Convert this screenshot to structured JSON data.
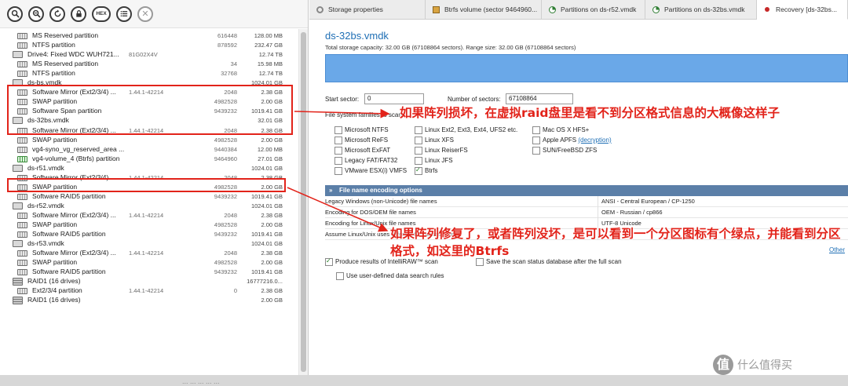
{
  "toolbar": {
    "buttons": [
      {
        "label": "",
        "icon": "search-icon"
      },
      {
        "label": "",
        "icon": "zoom-icon"
      },
      {
        "label": "",
        "icon": "refresh-icon"
      },
      {
        "label": "",
        "icon": "lock-icon"
      },
      {
        "label": "HEX",
        "icon": "hex-icon"
      },
      {
        "label": "",
        "icon": "list-icon"
      },
      {
        "label": "✕",
        "icon": "close-icon"
      }
    ]
  },
  "tree": [
    {
      "name": "MS Reserved partition",
      "pos": "",
      "sectors": "616448",
      "size": "128.00 MB",
      "icon": "partition"
    },
    {
      "name": "NTFS partition",
      "pos": "",
      "sectors": "878592",
      "size": "232.47 GB",
      "icon": "partition"
    },
    {
      "name": "Drive4: Fixed WDC  WUH721...",
      "pos": "81G02X4V",
      "sectors": "",
      "size": "12.74 TB",
      "icon": "disk"
    },
    {
      "name": "MS Reserved partition",
      "pos": "",
      "sectors": "34",
      "size": "15.98 MB",
      "icon": "partition"
    },
    {
      "name": "NTFS partition",
      "pos": "",
      "sectors": "32768",
      "size": "12.74 TB",
      "icon": "partition"
    },
    {
      "name": "ds-bs.vmdk",
      "pos": "",
      "sectors": "",
      "size": "1024.01 GB",
      "icon": "disk"
    },
    {
      "name": "Software Mirror (Ext2/3/4) ...",
      "pos": "1.44.1-42214",
      "sectors": "2048",
      "size": "2.38 GB",
      "icon": "partition"
    },
    {
      "name": "SWAP partition",
      "pos": "",
      "sectors": "4982528",
      "size": "2.00 GB",
      "icon": "partition"
    },
    {
      "name": "Software Span partition",
      "pos": "",
      "sectors": "9439232",
      "size": "1019.41 GB",
      "icon": "partition"
    },
    {
      "name": "ds-32bs.vmdk",
      "pos": "",
      "sectors": "",
      "size": "32.01 GB",
      "icon": "disk"
    },
    {
      "name": "Software Mirror (Ext2/3/4) ...",
      "pos": "1.44.1-42214",
      "sectors": "2048",
      "size": "2.38 GB",
      "icon": "partition"
    },
    {
      "name": "SWAP partition",
      "pos": "",
      "sectors": "4982528",
      "size": "2.00 GB",
      "icon": "partition"
    },
    {
      "name": "vg4-syno_vg_reserved_area ...",
      "pos": "",
      "sectors": "9440384",
      "size": "12.00 MB",
      "icon": "partition"
    },
    {
      "name": "vg4-volume_4 (Btrfs) partition",
      "pos": "",
      "sectors": "9464960",
      "size": "27.01 GB",
      "icon": "green"
    },
    {
      "name": "ds-r51.vmdk",
      "pos": "",
      "sectors": "",
      "size": "1024.01 GB",
      "icon": "disk"
    },
    {
      "name": "Software Mirror (Ext2/3/4) ...",
      "pos": "1.44.1-42214",
      "sectors": "2048",
      "size": "2.38 GB",
      "icon": "partition"
    },
    {
      "name": "SWAP partition",
      "pos": "",
      "sectors": "4982528",
      "size": "2.00 GB",
      "icon": "partition"
    },
    {
      "name": "Software RAID5 partition",
      "pos": "",
      "sectors": "9439232",
      "size": "1019.41 GB",
      "icon": "partition"
    },
    {
      "name": "ds-r52.vmdk",
      "pos": "",
      "sectors": "",
      "size": "1024.01 GB",
      "icon": "disk"
    },
    {
      "name": "Software Mirror (Ext2/3/4) ...",
      "pos": "1.44.1-42214",
      "sectors": "2048",
      "size": "2.38 GB",
      "icon": "partition"
    },
    {
      "name": "SWAP partition",
      "pos": "",
      "sectors": "4982528",
      "size": "2.00 GB",
      "icon": "partition"
    },
    {
      "name": "Software RAID5 partition",
      "pos": "",
      "sectors": "9439232",
      "size": "1019.41 GB",
      "icon": "partition"
    },
    {
      "name": "ds-r53.vmdk",
      "pos": "",
      "sectors": "",
      "size": "1024.01 GB",
      "icon": "disk"
    },
    {
      "name": "Software Mirror (Ext2/3/4) ...",
      "pos": "1.44.1-42214",
      "sectors": "2048",
      "size": "2.38 GB",
      "icon": "partition"
    },
    {
      "name": "SWAP partition",
      "pos": "",
      "sectors": "4982528",
      "size": "2.00 GB",
      "icon": "partition"
    },
    {
      "name": "Software RAID5 partition",
      "pos": "",
      "sectors": "9439232",
      "size": "1019.41 GB",
      "icon": "partition"
    },
    {
      "name": "RAID1 (16 drives)",
      "pos": "",
      "sectors": "",
      "size": "16777216.0...",
      "icon": "raid"
    },
    {
      "name": "Ext2/3/4 partition",
      "pos": "1.44.1-42214",
      "sectors": "0",
      "size": "2.38 GB",
      "icon": "partition"
    },
    {
      "name": "RAID1 (16 drives)",
      "pos": "",
      "sectors": "",
      "size": "2.00 GB",
      "icon": "raid"
    }
  ],
  "tabs": [
    {
      "label": "Storage properties",
      "icon": "gear"
    },
    {
      "label": "Btrfs volume (sector 9464960...",
      "icon": "vol"
    },
    {
      "label": "Partitions on ds-r52.vmdk",
      "icon": "pie"
    },
    {
      "label": "Partitions on ds-32bs.vmdk",
      "icon": "pie"
    },
    {
      "label": "Recovery [ds-32bs...",
      "icon": "rec"
    }
  ],
  "main": {
    "title": "ds-32bs.vmdk",
    "capacity": "Total storage capacity: 32.00 GB (67108864 sectors). Range size: 32.00 GB (67108864 sectors)",
    "start_label": "Start sector:",
    "start_value": "0",
    "num_label": "Number of sectors:",
    "num_value": "67108864",
    "fs_label": "File system families to scan",
    "fs_col1": [
      {
        "label": "Microsoft NTFS",
        "checked": false
      },
      {
        "label": "Microsoft ReFS",
        "checked": false
      },
      {
        "label": "Microsoft ExFAT",
        "checked": false
      },
      {
        "label": "Legacy FAT/FAT32",
        "checked": false
      },
      {
        "label": "VMware ESX(i) VMFS",
        "checked": false
      }
    ],
    "fs_col2": [
      {
        "label": "Linux Ext2, Ext3, Ext4, UFS2 etc.",
        "checked": false
      },
      {
        "label": "Linux XFS",
        "checked": false
      },
      {
        "label": "Linux ReiserFS",
        "checked": false
      },
      {
        "label": "Linux JFS",
        "checked": false
      },
      {
        "label": "Btrfs",
        "checked": true
      }
    ],
    "fs_col3": [
      {
        "label": "Mac OS X HFS+",
        "checked": false
      },
      {
        "label": "Apple APFS",
        "checked": false,
        "link": "(decryption)"
      },
      {
        "label": "SUN/FreeBSD ZFS",
        "checked": false
      }
    ],
    "enc_header": "File name encoding options",
    "enc_rows": [
      {
        "key": "Legacy Windows (non-Unicode) file names",
        "value": "ANSI - Central European / CP-1250"
      },
      {
        "key": "Encoding for DOS/OEM file names",
        "value": "OEM - Russian / cp866"
      },
      {
        "key": "Encoding for Linux/Unix file names",
        "value": "UTF-8 Unicode"
      },
      {
        "key": "Assume Linux/Unix uses different file names format",
        "value": ""
      }
    ],
    "others_link": "Other",
    "opt1": "Produce results of IntelliRAW™ scan",
    "opt2": "Save the scan status database after the full scan",
    "opt3": "Use user-defined data search rules"
  },
  "annotations": {
    "note1": "如果阵列损坏，在虚拟raid盘里是看不到分区格式信息的大概像这样子",
    "note2": "如果阵列修复了，或者阵列没坏，是可以看到一个分区图标有个绿点，并能看到分区格式，如这里的Btrfs"
  },
  "watermark": "什么值得买",
  "bottom_text": "... ... ... ... ...",
  "colors": {
    "accent": "#1f6fb5",
    "annotation": "#e2231a",
    "bar": "#6aa8e8",
    "header": "#5b7fa8"
  }
}
